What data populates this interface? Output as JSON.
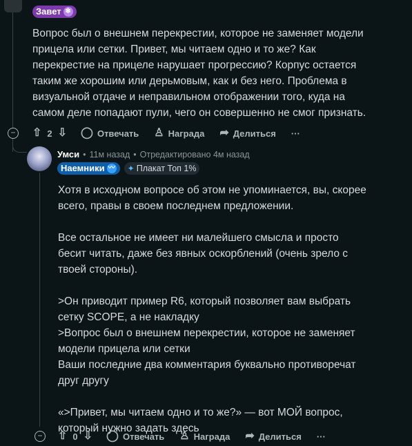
{
  "parent_comment": {
    "flair": {
      "label": "Завет",
      "emoji": "❄"
    },
    "paragraphs": [
      "Вопрос был о внешнем перекрестии, которое не заменяет модели прицела или сетки. Привет, мы читаем одно и то же? Как перекрестие на прицеле нарушает прогрессию? Корпус остается таким же хорошим или дерьмовым, как и без него. Проблема в визуальной отдаче и неправильном отображении того, куда на самом деле попадают пули, чего он совершенно не смог признать."
    ],
    "actions": {
      "score": "2",
      "reply": "Отвечать",
      "award": "Награда",
      "share": "Делиться",
      "more": "···"
    }
  },
  "reply_comment": {
    "username": "Умси",
    "time": "11м назад",
    "edited": "Отредактировано 4м назад",
    "flair": {
      "label": "Наемники",
      "emoji": "〰"
    },
    "badge": "Плакат Топ 1%",
    "paragraphs": [
      "Хотя в исходном вопросе об этом не упоминается, вы, скорее всего, правы в своем последнем предложении.",
      "Все остальное не имеет ни малейшего смысла и просто бесит читать, даже без явных оскорблений (очень зрело с твоей стороны).",
      ">Он приводит пример R6, который позволяет вам выбрать сетку SCOPE, а не накладку",
      ">Вопрос был о внешнем перекрестии, которое не заменяет модели прицела или сетки",
      "Ваши последние два комментария буквально противоречат друг другу",
      "«>Привет, мы читаем одно и то же?» — вот МОЙ вопрос, который нужно задать здесь"
    ],
    "actions": {
      "score": "0",
      "reply": "Отвечать",
      "award": "Награда",
      "share": "Делиться",
      "more": "···"
    }
  },
  "colors": {
    "background": "#0b1416",
    "text": "#d7dadc",
    "muted": "#8a9599",
    "flair_zavet": "#7c3aad",
    "flair_merc": "#0e5ea8"
  }
}
